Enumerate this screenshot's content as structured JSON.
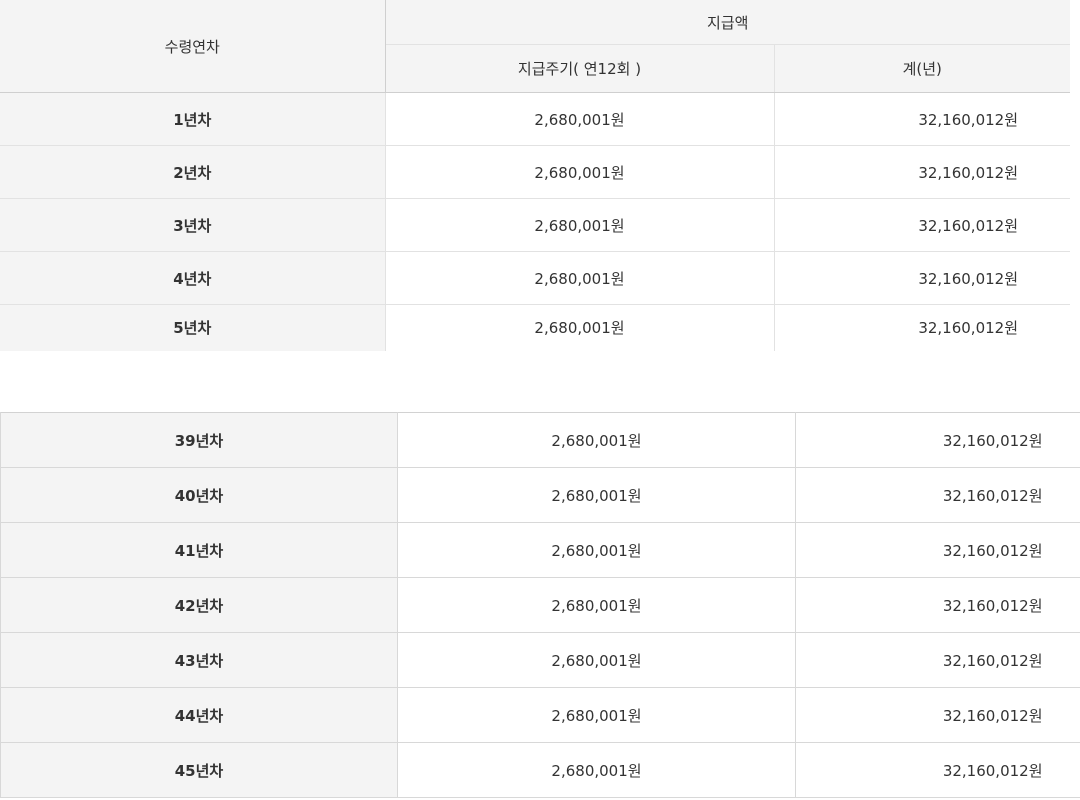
{
  "header": {
    "year_col": "수령연차",
    "amount_group": "지급액",
    "monthly_col": "지급주기( 연12회 )",
    "annual_col": "계(년)"
  },
  "table_top": [
    {
      "year": "1년차",
      "monthly": "2,680,001원",
      "annual": "32,160,012원"
    },
    {
      "year": "2년차",
      "monthly": "2,680,001원",
      "annual": "32,160,012원"
    },
    {
      "year": "3년차",
      "monthly": "2,680,001원",
      "annual": "32,160,012원"
    },
    {
      "year": "4년차",
      "monthly": "2,680,001원",
      "annual": "32,160,012원"
    },
    {
      "year": "5년차",
      "monthly": "2,680,001원",
      "annual": "32,160,012원"
    }
  ],
  "table_bottom": [
    {
      "year": "39년차",
      "monthly": "2,680,001원",
      "annual": "32,160,012원"
    },
    {
      "year": "40년차",
      "monthly": "2,680,001원",
      "annual": "32,160,012원"
    },
    {
      "year": "41년차",
      "monthly": "2,680,001원",
      "annual": "32,160,012원"
    },
    {
      "year": "42년차",
      "monthly": "2,680,001원",
      "annual": "32,160,012원"
    },
    {
      "year": "43년차",
      "monthly": "2,680,001원",
      "annual": "32,160,012원"
    },
    {
      "year": "44년차",
      "monthly": "2,680,001원",
      "annual": "32,160,012원"
    },
    {
      "year": "45년차",
      "monthly": "2,680,001원",
      "annual": "32,160,012원"
    }
  ]
}
